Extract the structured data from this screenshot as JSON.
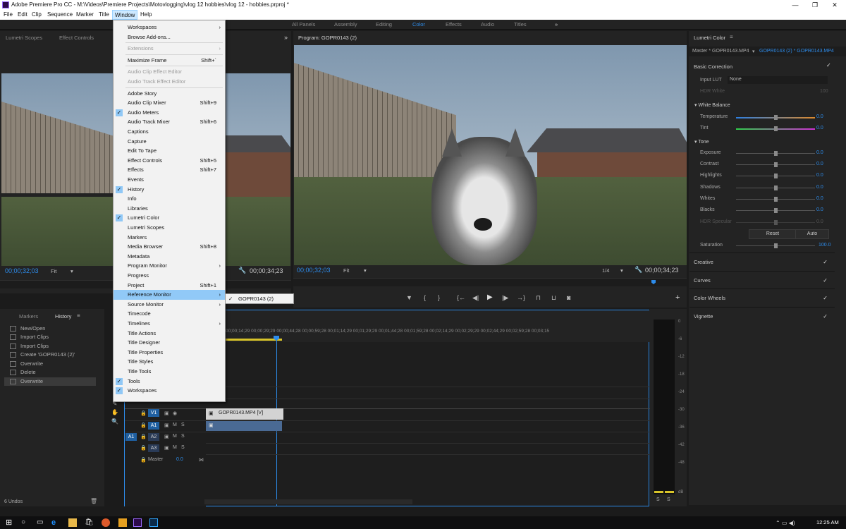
{
  "titlebar": {
    "title": "Adobe Premiere Pro CC - M:\\Videos\\Premiere Projects\\Motovlogging\\vlog 12 hobbies\\vlog 12 - hobbies.prproj *",
    "minimize": "—",
    "maximize": "❐",
    "close": "✕"
  },
  "menubar": [
    "File",
    "Edit",
    "Clip",
    "Sequence",
    "Marker",
    "Title",
    "Window",
    "Help"
  ],
  "workspaces": {
    "items": [
      "All Panels",
      "Assembly",
      "Editing",
      "Color",
      "Effects",
      "Audio",
      "Titles"
    ],
    "active": "Color",
    "more": "»"
  },
  "source_panel": {
    "tabs": [
      "Lumetri Scopes",
      "Effect Controls"
    ],
    "timecode": "00;00;32;03",
    "fit": "Fit",
    "right_timecode": "00;00;34;23"
  },
  "program": {
    "tab": "Program: GOPR0143 (2)",
    "timecode": "00;00;32;03",
    "fit": "Fit",
    "quality": "1/4",
    "duration": "00;00;34;23"
  },
  "window_menu": {
    "items": [
      {
        "label": "Workspaces",
        "arrow": "›"
      },
      {
        "label": "Browse Add-ons..."
      },
      {
        "label": "Extensions",
        "arrow": "›",
        "disabled": true
      },
      {
        "label": "Maximize Frame",
        "shortcut": "Shift+`"
      },
      {
        "label": "Audio Clip Effect Editor",
        "disabled": true
      },
      {
        "label": "Audio Track Effect Editor",
        "disabled": true
      },
      {
        "label": "Adobe Story"
      },
      {
        "label": "Audio Clip Mixer",
        "shortcut": "Shift+9"
      },
      {
        "label": "Audio Meters",
        "checked": true
      },
      {
        "label": "Audio Track Mixer",
        "shortcut": "Shift+6"
      },
      {
        "label": "Captions"
      },
      {
        "label": "Capture"
      },
      {
        "label": "Edit To Tape"
      },
      {
        "label": "Effect Controls",
        "shortcut": "Shift+5"
      },
      {
        "label": "Effects",
        "shortcut": "Shift+7"
      },
      {
        "label": "Events"
      },
      {
        "label": "History",
        "checked": true
      },
      {
        "label": "Info"
      },
      {
        "label": "Libraries"
      },
      {
        "label": "Lumetri Color",
        "checked": true
      },
      {
        "label": "Lumetri Scopes"
      },
      {
        "label": "Markers"
      },
      {
        "label": "Media Browser",
        "shortcut": "Shift+8"
      },
      {
        "label": "Metadata"
      },
      {
        "label": "Program Monitor",
        "arrow": "›"
      },
      {
        "label": "Progress"
      },
      {
        "label": "Project",
        "shortcut": "Shift+1"
      },
      {
        "label": "Reference Monitor",
        "arrow": "›",
        "highlighted": true
      },
      {
        "label": "Source Monitor",
        "arrow": "›"
      },
      {
        "label": "Timecode"
      },
      {
        "label": "Timelines",
        "arrow": "›"
      },
      {
        "label": "Title Actions"
      },
      {
        "label": "Title Designer"
      },
      {
        "label": "Title Properties"
      },
      {
        "label": "Title Styles"
      },
      {
        "label": "Title Tools"
      },
      {
        "label": "Tools",
        "checked": true
      },
      {
        "label": "Workspaces",
        "checked": true
      }
    ],
    "submenu": {
      "label": "GOPR0143 (2)",
      "check": "✓"
    }
  },
  "history": {
    "tabs": [
      "Markers",
      "History"
    ],
    "items": [
      "New/Open",
      "Import Clips",
      "Import Clips",
      "Create 'GOPR0143 (2)'",
      "Overwrite",
      "Delete",
      "Overwrite"
    ],
    "footer": "6 Undos"
  },
  "timeline": {
    "ruler": [
      "00;00;14;29",
      "00;00;29;29",
      "00;00;44;28",
      "00;00;59;28",
      "00;01;14;29",
      "00;01;29;29",
      "00;01;44;28",
      "00;01;59;28",
      "00;02;14;29",
      "00;02;29;29",
      "00;02;44;29",
      "00;02;59;28",
      "00;03;15"
    ],
    "tracks": {
      "v1": "V1",
      "a1": "A1",
      "a2": "A2",
      "a3": "A3",
      "src_a1": "A1",
      "m": "M",
      "s": "S",
      "master": "Master",
      "master_val": "0.0"
    },
    "clip": "GOPR0143.MP4 [V]"
  },
  "meters": {
    "labels": [
      "0",
      "-6",
      "-12",
      "-18",
      "-24",
      "-30",
      "-36",
      "-42",
      "-48",
      "dB"
    ],
    "s": "S"
  },
  "lumetri": {
    "title": "Lumetri Color",
    "master": "Master * GOPR0143.MP4",
    "clip": "GOPR0143 (2) * GOPR0143.MP4",
    "basic": "Basic Correction",
    "input_lut_label": "Input LUT",
    "input_lut": "None",
    "hdr_white": "HDR White",
    "hdr_white_val": "100",
    "wb": "White Balance",
    "temperature": "Temperature",
    "tint": "Tint",
    "tone": "Tone",
    "rows": [
      {
        "label": "Exposure",
        "value": "0.0"
      },
      {
        "label": "Contrast",
        "value": "0.0"
      },
      {
        "label": "Highlights",
        "value": "0.0"
      },
      {
        "label": "Shadows",
        "value": "0.0"
      },
      {
        "label": "Whites",
        "value": "0.0"
      },
      {
        "label": "Blacks",
        "value": "0.0"
      }
    ],
    "temp_val": "0.0",
    "tint_val": "0.0",
    "hdr_spec": "HDR Specular",
    "hdr_spec_val": "0.0",
    "reset": "Reset",
    "auto": "Auto",
    "saturation": "Saturation",
    "saturation_val": "100.0",
    "sections": [
      "Creative",
      "Curves",
      "Color Wheels",
      "Vignette"
    ]
  },
  "taskbar": {
    "time": "12:25 AM"
  }
}
